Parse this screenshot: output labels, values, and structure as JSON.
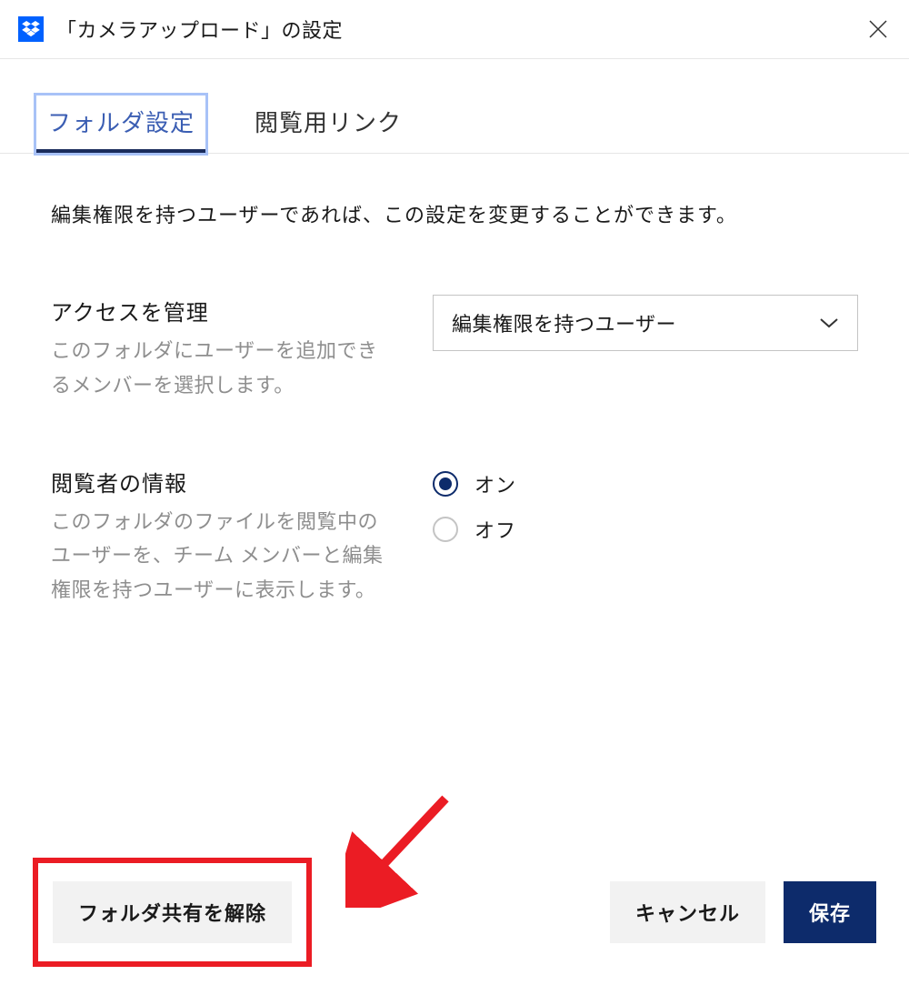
{
  "header": {
    "title": "「カメラアップロード」の設定"
  },
  "tabs": {
    "folder_settings": "フォルダ設定",
    "view_link": "閲覧用リンク"
  },
  "info_text": "編集権限を持つユーザーであれば、この設定を変更することができます。",
  "access": {
    "title": "アクセスを管理",
    "desc": "このフォルダにユーザーを追加できるメンバーを選択します。",
    "selected": "編集権限を持つユーザー"
  },
  "viewer": {
    "title": "閲覧者の情報",
    "desc": "このフォルダのファイルを閲覧中のユーザーを、チーム メンバーと編集権限を持つユーザーに表示します。",
    "on_label": "オン",
    "off_label": "オフ"
  },
  "footer": {
    "unshare": "フォルダ共有を解除",
    "cancel": "キャンセル",
    "save": "保存"
  }
}
